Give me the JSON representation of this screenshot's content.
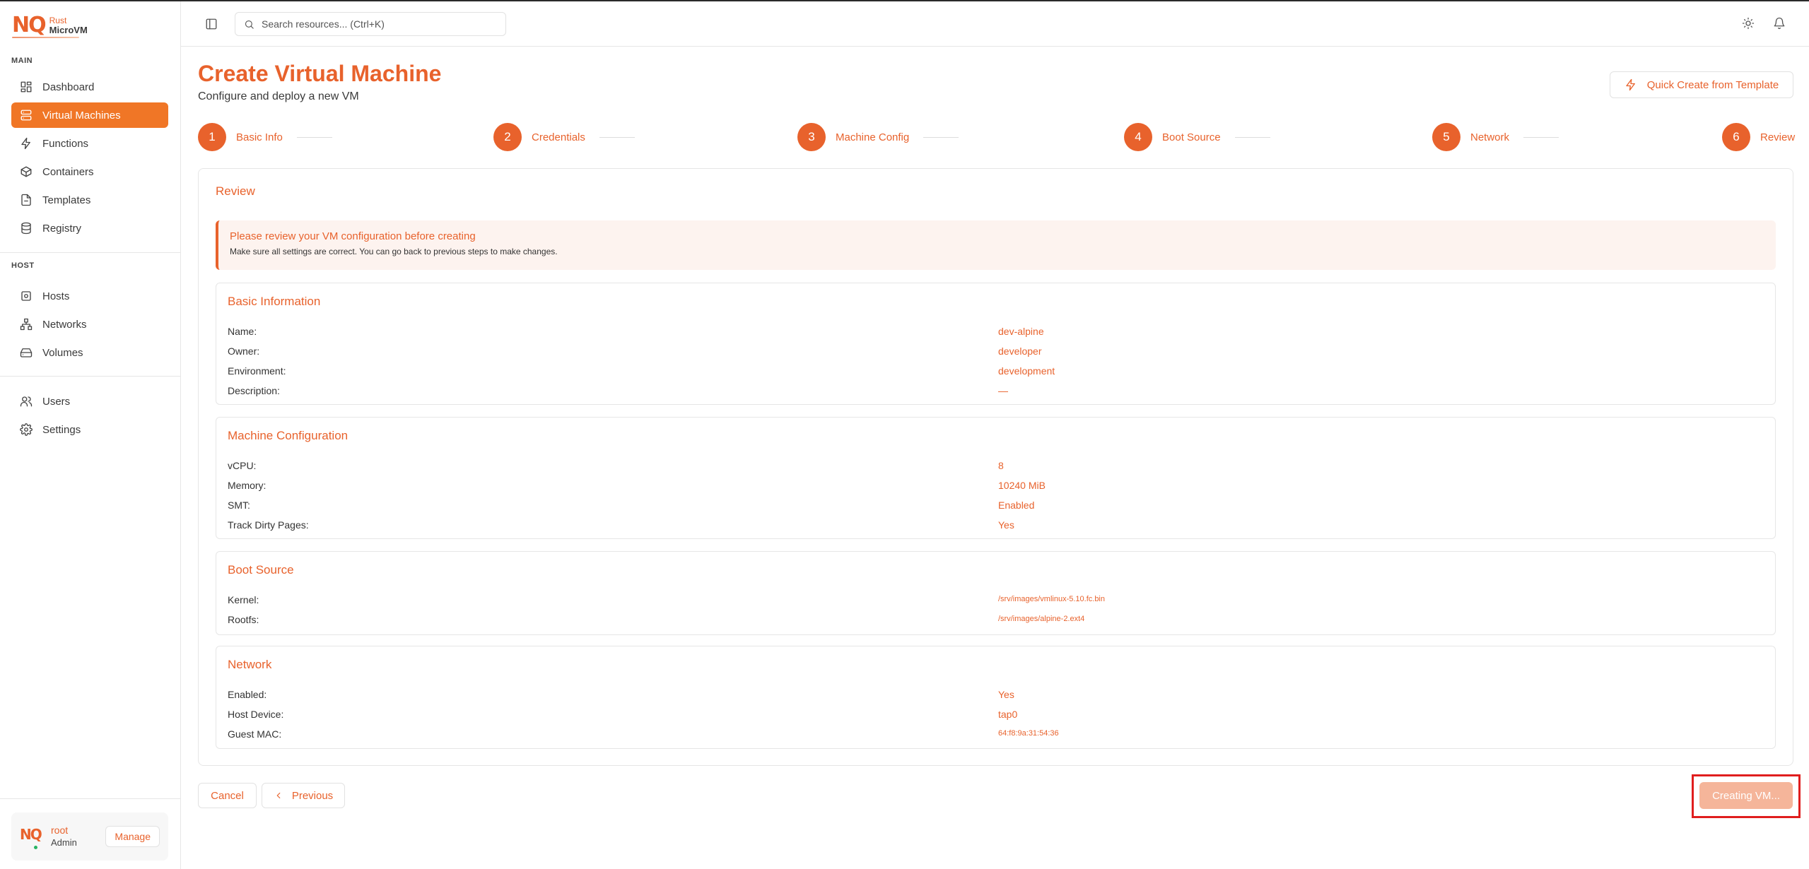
{
  "brand": {
    "logo_mark": "NQ",
    "line1": "Rust",
    "line2": "MicroVM"
  },
  "sidebar": {
    "section_main": "MAIN",
    "section_host": "HOST",
    "main_items": [
      {
        "label": "Dashboard",
        "icon": "grid-icon"
      },
      {
        "label": "Virtual Machines",
        "icon": "server-icon",
        "active": true
      },
      {
        "label": "Functions",
        "icon": "bolt-icon"
      },
      {
        "label": "Containers",
        "icon": "box-icon"
      },
      {
        "label": "Templates",
        "icon": "file-icon"
      },
      {
        "label": "Registry",
        "icon": "database-icon"
      }
    ],
    "host_items": [
      {
        "label": "Hosts",
        "icon": "host-icon"
      },
      {
        "label": "Networks",
        "icon": "network-icon"
      },
      {
        "label": "Volumes",
        "icon": "drive-icon"
      }
    ],
    "other_items": [
      {
        "label": "Users",
        "icon": "users-icon"
      },
      {
        "label": "Settings",
        "icon": "gear-icon"
      }
    ],
    "user": {
      "avatar": "NQ",
      "name": "root",
      "role": "Admin",
      "manage_label": "Manage"
    }
  },
  "header": {
    "search_placeholder": "Search resources... (Ctrl+K)"
  },
  "page": {
    "title": "Create Virtual Machine",
    "subtitle": "Configure and deploy a new VM",
    "quick_create_label": "Quick Create from Template"
  },
  "steps": [
    {
      "num": "1",
      "label": "Basic Info"
    },
    {
      "num": "2",
      "label": "Credentials"
    },
    {
      "num": "3",
      "label": "Machine Config"
    },
    {
      "num": "4",
      "label": "Boot Source"
    },
    {
      "num": "5",
      "label": "Network"
    },
    {
      "num": "6",
      "label": "Review"
    }
  ],
  "review": {
    "title": "Review",
    "alert_title": "Please review your VM configuration before creating",
    "alert_text": "Make sure all settings are correct. You can go back to previous steps to make changes.",
    "sections": [
      {
        "title": "Basic Information",
        "rows": [
          {
            "key": "Name:",
            "value": "dev-alpine"
          },
          {
            "key": "Owner:",
            "value": "developer"
          },
          {
            "key": "Environment:",
            "value": "development"
          },
          {
            "key": "Description:",
            "value": "—"
          }
        ]
      },
      {
        "title": "Machine Configuration",
        "rows": [
          {
            "key": "vCPU:",
            "value": "8"
          },
          {
            "key": "Memory:",
            "value": "10240 MiB"
          },
          {
            "key": "SMT:",
            "value": "Enabled"
          },
          {
            "key": "Track Dirty Pages:",
            "value": "Yes"
          }
        ]
      },
      {
        "title": "Boot Source",
        "rows": [
          {
            "key": "Kernel:",
            "value": "/srv/images/vmlinux-5.10.fc.bin"
          },
          {
            "key": "Rootfs:",
            "value": "/srv/images/alpine-2.ext4"
          }
        ]
      },
      {
        "title": "Network",
        "rows": [
          {
            "key": "Enabled:",
            "value": "Yes"
          },
          {
            "key": "Host Device:",
            "value": "tap0"
          },
          {
            "key": "Guest MAC:",
            "value": "64:f8:9a:31:54:36"
          }
        ]
      }
    ]
  },
  "actions": {
    "cancel_label": "Cancel",
    "previous_label": "Previous",
    "creating_label": "Creating VM..."
  },
  "colors": {
    "accent": "#e8622c",
    "active_nav": "#f07626",
    "highlight": "#e01e1e"
  }
}
